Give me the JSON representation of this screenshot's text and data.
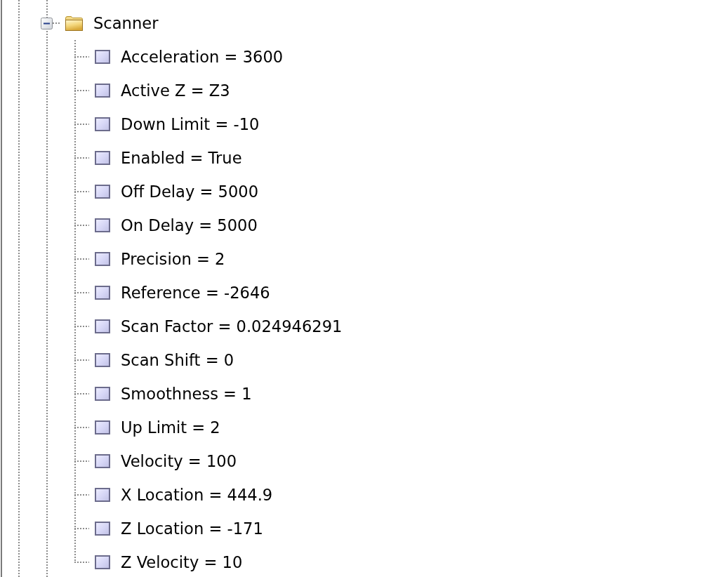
{
  "tree": {
    "nodes": [
      {
        "label": "Scanner",
        "kind": "folder",
        "expanded": true,
        "selected": false,
        "children": [
          {
            "label": "Acceleration = 3600",
            "kind": "property",
            "selected": false
          },
          {
            "label": "Active Z = Z3",
            "kind": "property",
            "selected": false
          },
          {
            "label": "Down Limit = -10",
            "kind": "property",
            "selected": false
          },
          {
            "label": "Enabled = True",
            "kind": "property",
            "selected": false
          },
          {
            "label": "Off Delay = 5000",
            "kind": "property",
            "selected": false
          },
          {
            "label": "On Delay = 5000",
            "kind": "property",
            "selected": false
          },
          {
            "label": "Precision = 2",
            "kind": "property",
            "selected": false
          },
          {
            "label": "Reference = -2646",
            "kind": "property",
            "selected": false
          },
          {
            "label": "Scan Factor = 0.024946291",
            "kind": "property",
            "selected": false
          },
          {
            "label": "Scan Shift = 0",
            "kind": "property",
            "selected": false
          },
          {
            "label": "Smoothness = 1",
            "kind": "property",
            "selected": false
          },
          {
            "label": "Up Limit = 2",
            "kind": "property",
            "selected": false
          },
          {
            "label": "Velocity = 100",
            "kind": "property",
            "selected": false
          },
          {
            "label": "X Location = 444.9",
            "kind": "property",
            "selected": false
          },
          {
            "label": "Z Location = -171",
            "kind": "property",
            "selected": false
          },
          {
            "label": "Z Velocity = 10",
            "kind": "property",
            "selected": false
          }
        ]
      }
    ]
  }
}
